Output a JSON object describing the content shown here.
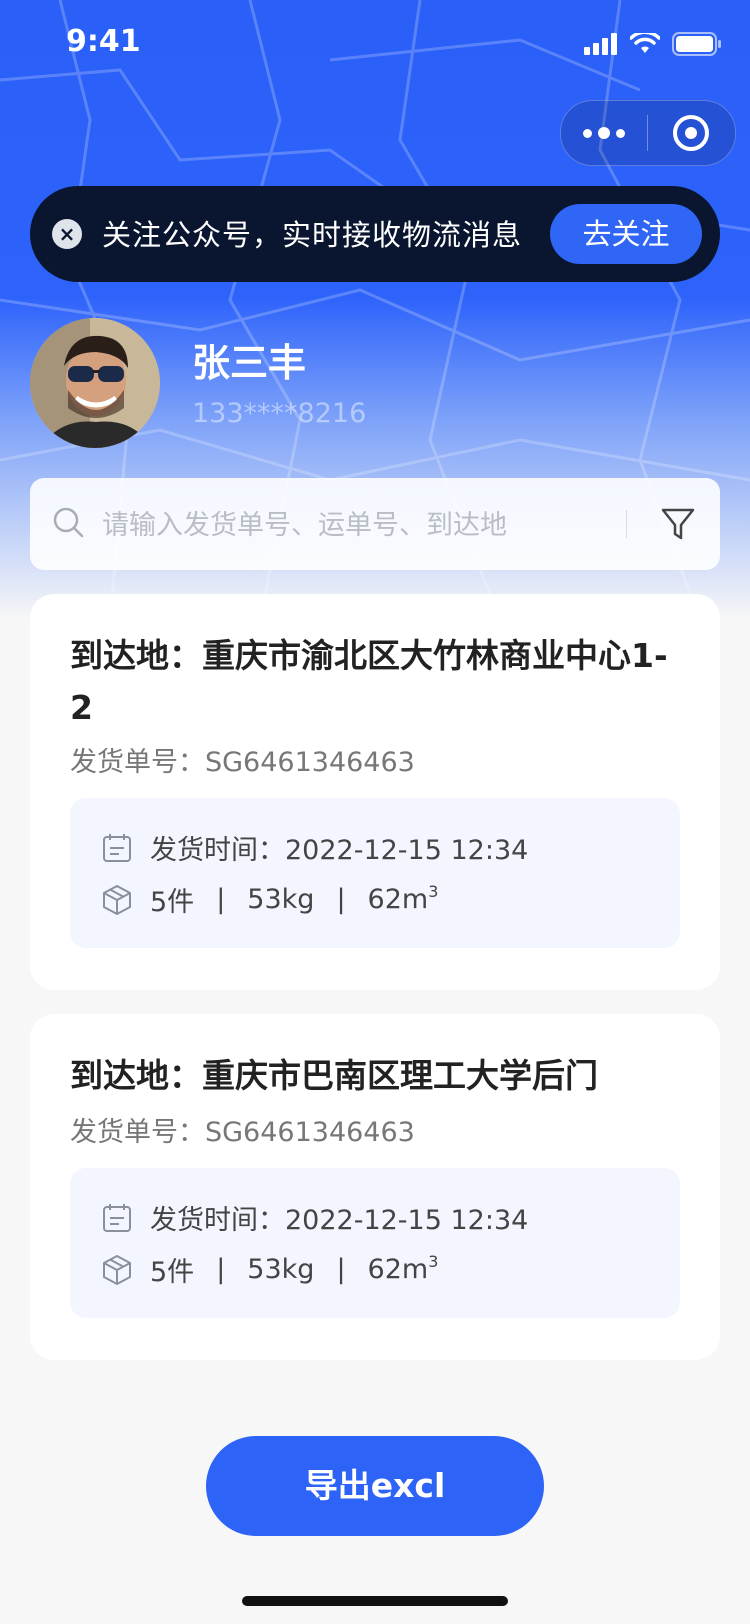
{
  "status_bar": {
    "time": "9:41"
  },
  "follow_banner": {
    "text": "关注公众号，实时接收物流消息",
    "button_label": "去关注",
    "close_glyph": "×"
  },
  "user": {
    "name": "张三丰",
    "phone": "133****8216"
  },
  "search": {
    "placeholder": "请输入发货单号、运单号、到达地"
  },
  "cards": [
    {
      "title": "到达地：重庆市渝北区大竹林商业中心1-2",
      "order": "发货单号：SG6461346463",
      "ship_time": "发货时间：2022-12-15 12:34",
      "pieces": "5件",
      "weight": "53kg",
      "volume": "62m",
      "volume_sup": "3"
    },
    {
      "title": "到达地：重庆市巴南区理工大学后门",
      "order": "发货单号：SG6461346463",
      "ship_time": "发货时间：2022-12-15 12:34",
      "pieces": "5件",
      "weight": "53kg",
      "volume": "62m",
      "volume_sup": "3"
    }
  ],
  "footer": {
    "export_label": "导出excl"
  },
  "colors": {
    "primary": "#2d63f6",
    "banner_bg": "#0a1630",
    "info_bg": "#f3f6fe"
  },
  "icons": [
    "signal-icon",
    "wifi-icon",
    "battery-icon",
    "more-icon",
    "target-icon",
    "close-icon",
    "search-icon",
    "filter-icon",
    "calendar-icon",
    "box-icon"
  ]
}
